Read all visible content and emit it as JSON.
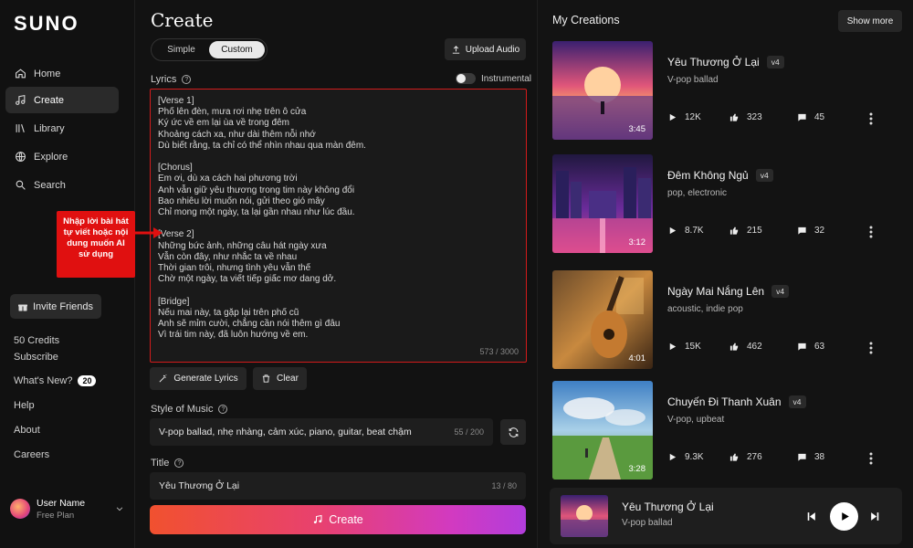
{
  "sidebar": {
    "logo": "SUNO",
    "nav": [
      {
        "label": "Home",
        "icon": "home-icon"
      },
      {
        "label": "Create",
        "icon": "music-note-icon",
        "active": true
      },
      {
        "label": "Library",
        "icon": "library-icon"
      },
      {
        "label": "Explore",
        "icon": "globe-icon"
      },
      {
        "label": "Search",
        "icon": "search-icon"
      }
    ],
    "invite_label": "Invite Friends",
    "credits": "50 Credits",
    "subscribe": "Subscribe",
    "whats_new": "What's New?",
    "whats_new_count": "20",
    "help": "Help",
    "about": "About",
    "careers": "Careers",
    "user": {
      "name": "User Name",
      "plan": "Free Plan"
    }
  },
  "main": {
    "title": "Create",
    "modes": [
      "Simple",
      "Custom"
    ],
    "active_mode": "Custom",
    "upload_label": "Upload Audio",
    "lyrics_label": "Lyrics",
    "instrumental_label": "Instrumental",
    "lyrics": "[Verse 1]\nPhố lên đèn, mưa rơi nhẹ trên ô cửa\nKý ức về em lại ùa về trong đêm\nKhoảng cách xa, như dài thêm nỗi nhớ\nDù biết rằng, ta chỉ có thể nhìn nhau qua màn đêm.\n\n[Chorus]\nEm ơi, dù xa cách hai phương trời\nAnh vẫn giữ yêu thương trong tim này không đổi\nBao nhiêu lời muốn nói, gửi theo gió mây\nChỉ mong một ngày, ta lại gần nhau như lúc đầu.\n\n[Verse 2]\nNhững bức ảnh, những câu hát ngày xưa\nVẫn còn đây, như nhắc ta về nhau\nThời gian trôi, nhưng tình yêu vẫn thế\nChờ một ngày, ta viết tiếp giấc mơ dang dở.\n\n[Bridge]\nNếu mai này, ta gặp lại trên phố cũ\nAnh sẽ mỉm cười, chẳng cần nói thêm gì đâu\nVì trái tim này, đã luôn hướng về em.",
    "lyrics_count": "573 / 3000",
    "generate_label": "Generate Lyrics",
    "clear_label": "Clear",
    "style_label": "Style of Music",
    "style_value": "V-pop ballad, nhẹ nhàng, cảm xúc, piano, guitar, beat chậm",
    "style_count": "55 / 200",
    "title_label": "Title",
    "title_value": "Yêu Thương Ở Lại",
    "title_count": "13 / 80",
    "create_label": "Create",
    "callout": "Nhập lời bài hát tự viết hoặc nội dung muốn AI sử dụng"
  },
  "creations": {
    "title": "My Creations",
    "show_more": "Show more",
    "songs": [
      {
        "title": "Yêu Thương Ở Lại",
        "version": "v4",
        "style": "V-pop ballad",
        "duration": "3:45",
        "plays": "12K",
        "likes": "323",
        "comments": "45"
      },
      {
        "title": "Đêm Không Ngủ",
        "version": "v4",
        "style": "pop, electronic",
        "duration": "3:12",
        "plays": "8.7K",
        "likes": "215",
        "comments": "32"
      },
      {
        "title": "Ngày Mai Nắng Lên",
        "version": "v4",
        "style": "acoustic, indie pop",
        "duration": "4:01",
        "plays": "15K",
        "likes": "462",
        "comments": "63"
      },
      {
        "title": "Chuyến Đi Thanh Xuân",
        "version": "v4",
        "style": "V-pop, upbeat",
        "duration": "3:28",
        "plays": "9.3K",
        "likes": "276",
        "comments": "38"
      }
    ]
  },
  "player": {
    "title": "Yêu Thương Ở Lại",
    "style": "V-pop ballad"
  },
  "colors": {
    "accent_red": "#e01010",
    "create_gradient_start": "#f1512f",
    "create_gradient_end": "#b23ddc"
  }
}
